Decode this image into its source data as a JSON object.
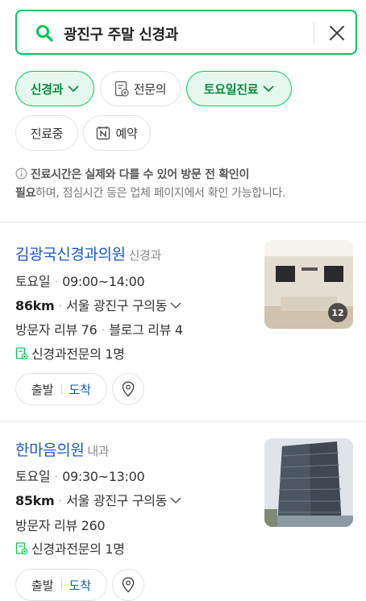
{
  "search": {
    "query": "광진구 주말 신경과"
  },
  "filters": [
    {
      "label": "신경과",
      "active": true
    },
    {
      "label": "전문의",
      "active": false
    },
    {
      "label": "토요일진료",
      "active": true
    },
    {
      "label": "진료중",
      "active": false
    },
    {
      "label": "예약",
      "active": false
    }
  ],
  "notice": {
    "bold1": "진료시간은 실제와 다를 수 있어 방문 전 확인이",
    "bold2": "필요",
    "rest": "하며, 점심시간 등은 업체 페이지에서 확인 가능합니다."
  },
  "results": [
    {
      "name": "김광국신경과의원",
      "category": "신경과",
      "day": "토요일",
      "hours": "09:00~14:00",
      "distance": "86km",
      "address": "서울 광진구 구의동",
      "reviews_visitor": "방문자 리뷰 76",
      "reviews_blog": "블로그 리뷰 4",
      "specialist": "신경과전문의 1명",
      "photo_count": "12",
      "start_label": "출발",
      "arrive_label": "도착"
    },
    {
      "name": "한마음의원",
      "category": "내과",
      "day": "토요일",
      "hours": "09:30~13:00",
      "distance": "85km",
      "address": "서울 광진구 구의동",
      "reviews_visitor": "방문자 리뷰 260",
      "reviews_blog": "",
      "specialist": "신경과전문의 1명",
      "photo_count": "",
      "start_label": "출발",
      "arrive_label": "도착"
    }
  ],
  "colors": {
    "accent": "#03c75a",
    "link": "#1a57c9"
  }
}
